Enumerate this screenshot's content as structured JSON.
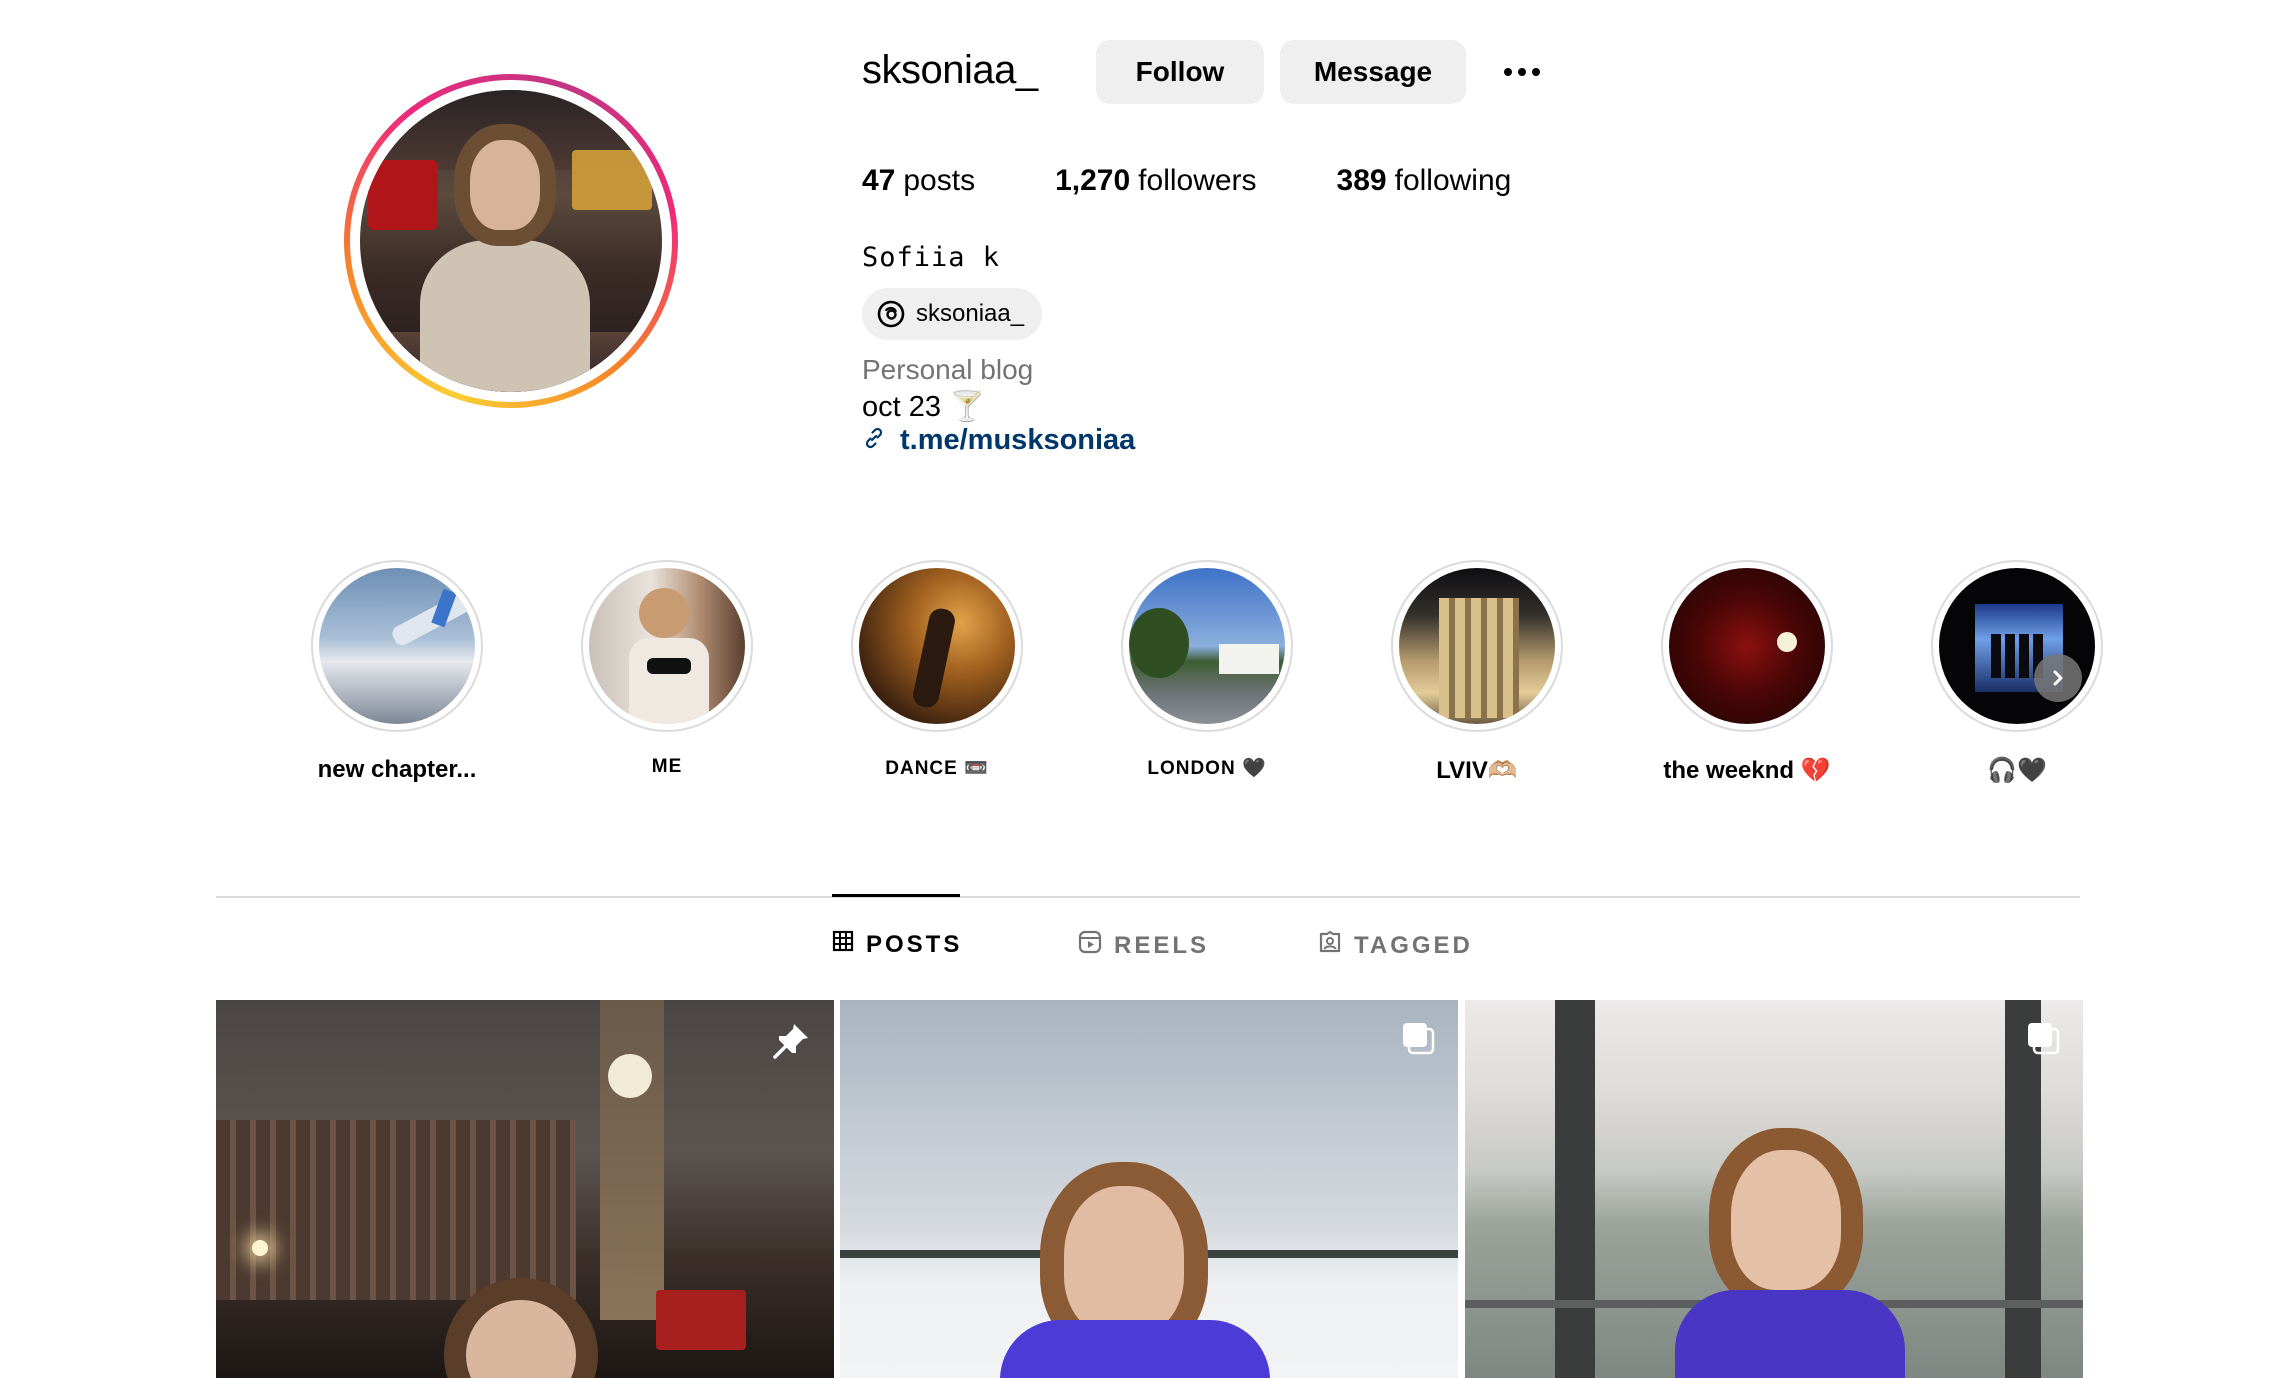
{
  "profile": {
    "username": "sksoniaa_",
    "follow_label": "Follow",
    "message_label": "Message",
    "stats": {
      "posts_count": "47",
      "posts_label": "posts",
      "followers_count": "1,270",
      "followers_label": "followers",
      "following_count": "389",
      "following_label": "following"
    },
    "full_name": "Sofiia k",
    "threads_handle": "sksoniaa_",
    "category": "Personal blog",
    "bio": "oct 23 🍸",
    "link": "t.me/musksoniaa"
  },
  "highlights": [
    {
      "label": "new chapter..."
    },
    {
      "label": "ME"
    },
    {
      "label": "DANCE 📼"
    },
    {
      "label": "LONDON 🖤"
    },
    {
      "label": "LVIV🫶🏼"
    },
    {
      "label": "the weeknd 💔"
    },
    {
      "label": "🎧🖤"
    }
  ],
  "tabs": {
    "posts": "POSTS",
    "reels": "REELS",
    "tagged": "TAGGED",
    "active": "posts"
  },
  "posts": [
    {
      "badge": "pin-icon"
    },
    {
      "badge": "carousel-icon"
    },
    {
      "badge": "carousel-icon"
    }
  ],
  "colors": {
    "button_bg": "#efefef",
    "link": "#00376b",
    "secondary_text": "#737373",
    "divider": "#dbdbdb"
  }
}
